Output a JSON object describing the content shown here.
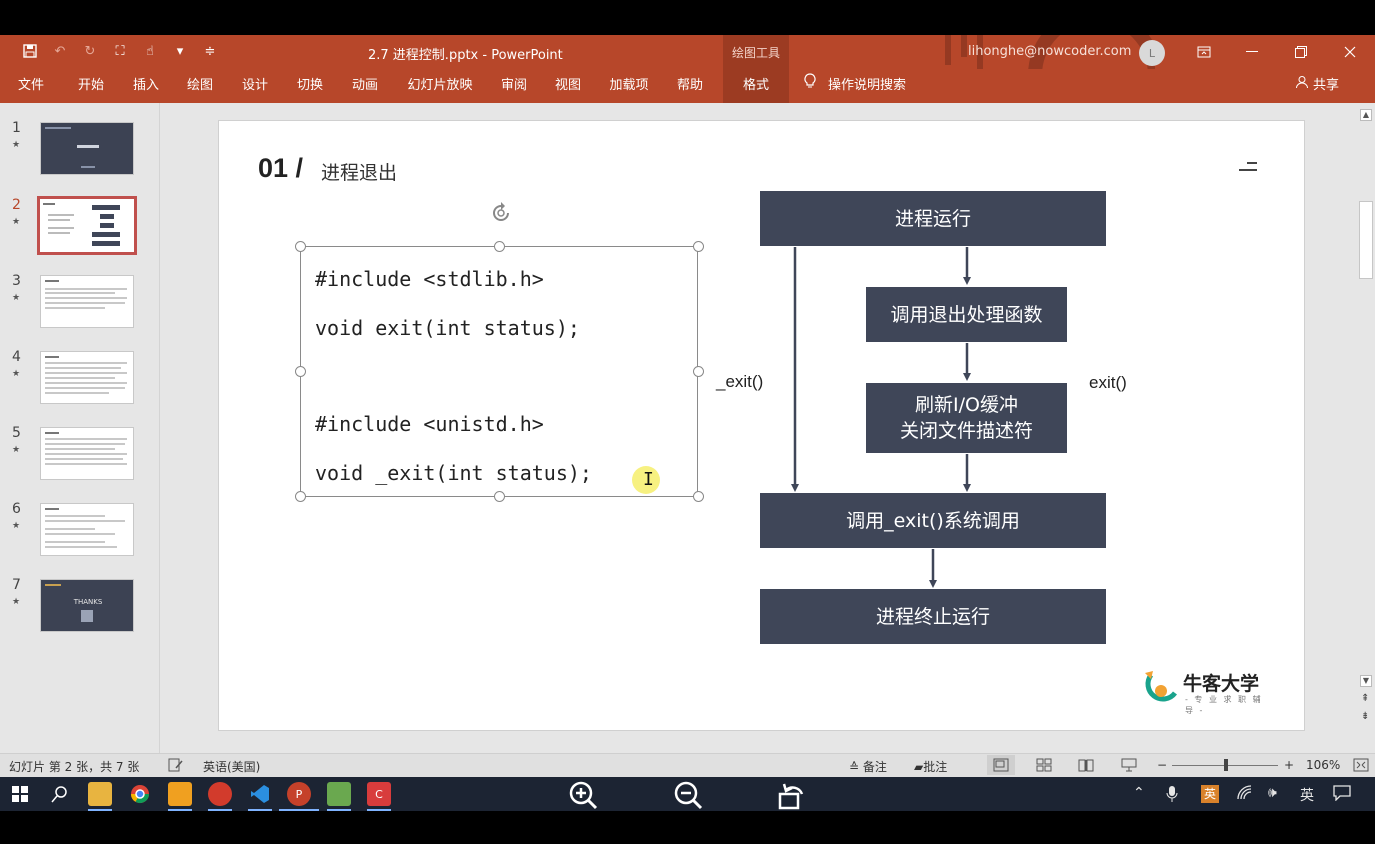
{
  "window": {
    "doc_title": "2.7 进程控制.pptx  -  PowerPoint",
    "tool_context": "绘图工具",
    "account": "lihonghe@nowcoder.com",
    "avatar_letter": "L"
  },
  "ribbon": {
    "tabs": [
      "文件",
      "开始",
      "插入",
      "绘图",
      "设计",
      "切换",
      "动画",
      "幻灯片放映",
      "审阅",
      "视图",
      "加载项",
      "帮助",
      "格式"
    ],
    "active_tab": "格式",
    "tell_me": "操作说明搜索",
    "share": "共享"
  },
  "thumbnails": {
    "numbers": [
      "1",
      "2",
      "3",
      "4",
      "5",
      "6",
      "7"
    ],
    "star": "★",
    "selected_number": "2",
    "thanks_text": "THANKS"
  },
  "slide": {
    "number": "01 /",
    "title": "进程退出",
    "code_lines": [
      "#include <stdlib.h>",
      "void exit(int status);",
      "#include <unistd.h>",
      "void _exit(int status);"
    ],
    "flow": {
      "box1": "进程运行",
      "box2": "调用退出处理函数",
      "box3_line1": "刷新I/O缓冲",
      "box3_line2": "关闭文件描述符",
      "box4": "调用_exit()系统调用",
      "box5": "进程终止运行",
      "left_label": "_exit()",
      "right_label": "exit()"
    },
    "brand_name": "牛客大学",
    "brand_tagline": "- 专 业 求 职 辅 导 -"
  },
  "status": {
    "slide_info": "幻灯片 第 2 张，共 7 张",
    "language": "英语(美国)",
    "notes": "备注",
    "comments": "批注",
    "zoom_minus": "−",
    "zoom_plus": "+",
    "zoom": "106%",
    "zoom_level_percent": 106
  },
  "taskbar": {
    "ime_lang": "英",
    "apps": [
      "file-explorer",
      "chrome",
      "app-orange",
      "app-red",
      "vscode",
      "powerpoint",
      "notepad",
      "app-c"
    ],
    "active_app": "powerpoint"
  },
  "colors": {
    "ribbon": "#b7472a",
    "ribbon_dark": "#9c3b22",
    "flow_box": "#3f4658",
    "selection_border": "#c0504d",
    "taskbar": "#1c2433"
  }
}
